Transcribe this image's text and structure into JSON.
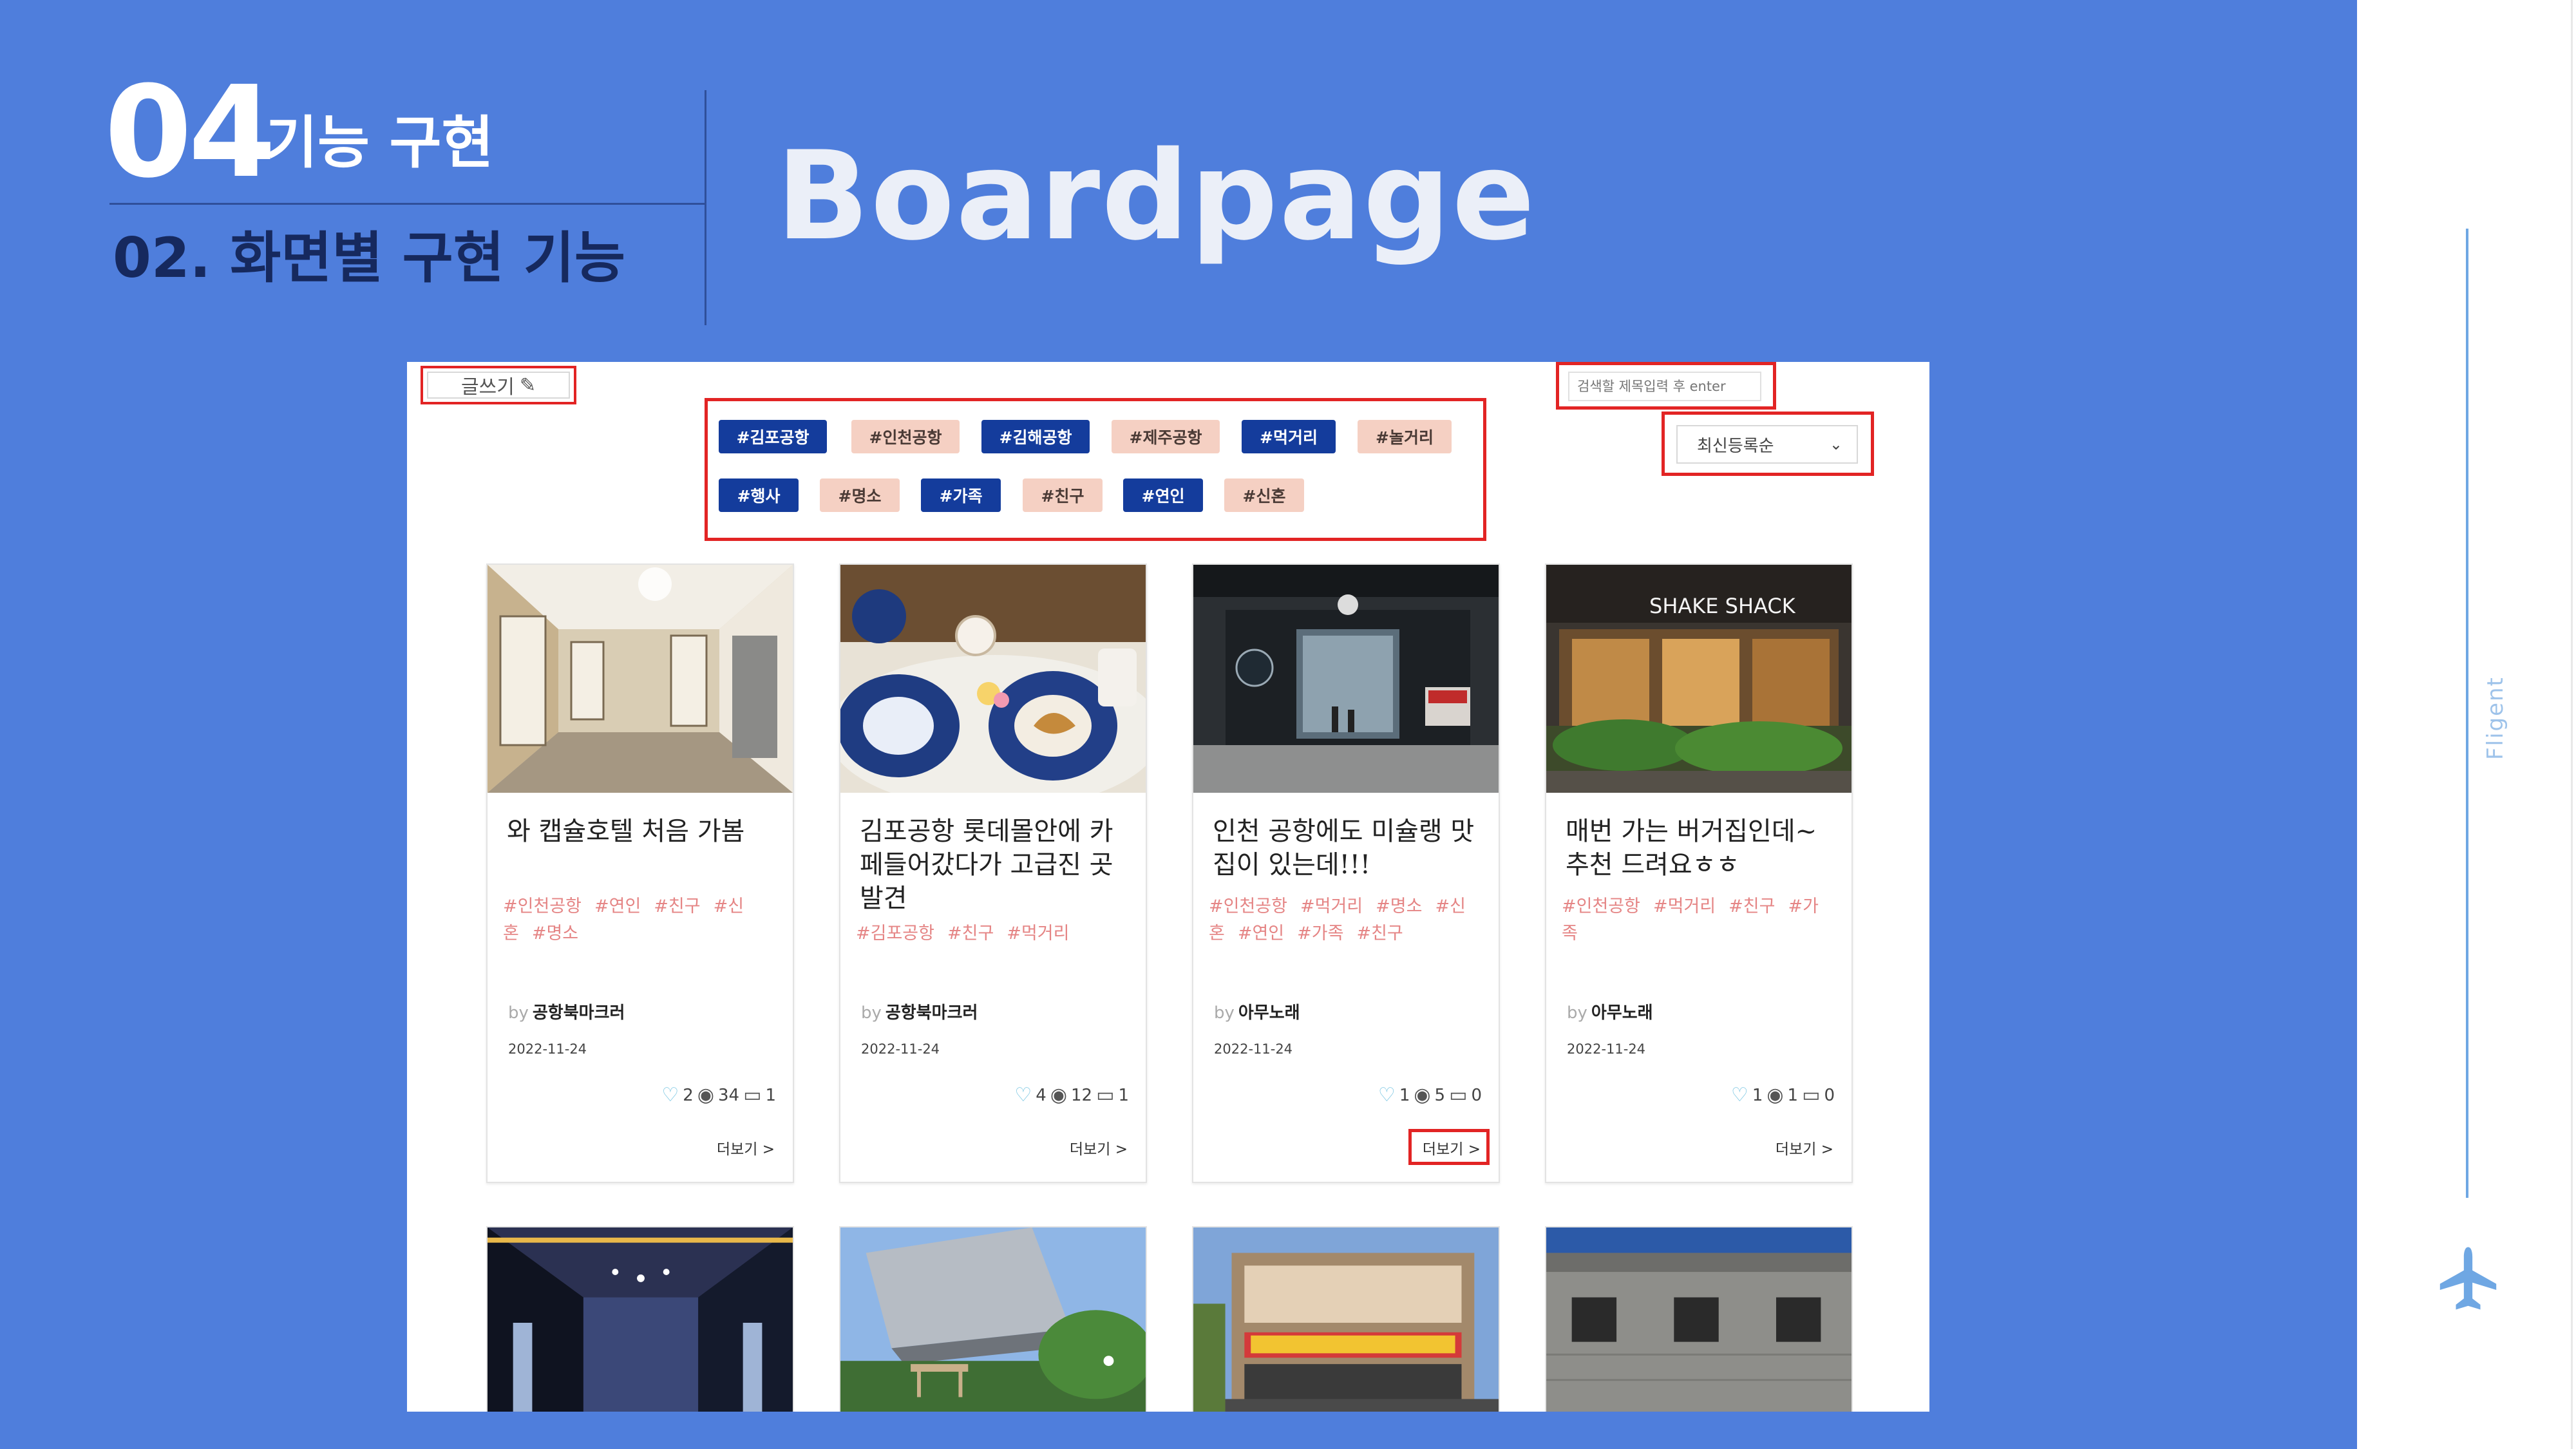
{
  "slide": {
    "number": "04",
    "subtitle": "기능 구현",
    "section": "02. 화면별 구현 기능",
    "page_title": "Boardpage",
    "brand": "Fligent"
  },
  "board": {
    "write_label": "글쓰기",
    "search_placeholder": "검색할 제목입력 후 enter",
    "sort_label": "최신등록순",
    "tags": [
      {
        "label": "#김포공항",
        "active": true
      },
      {
        "label": "#인천공항",
        "active": false
      },
      {
        "label": "#김해공항",
        "active": true
      },
      {
        "label": "#제주공항",
        "active": false
      },
      {
        "label": "#먹거리",
        "active": true
      },
      {
        "label": "#놀거리",
        "active": false
      },
      {
        "label": "#행사",
        "active": true
      },
      {
        "label": "#명소",
        "active": false
      },
      {
        "label": "#가족",
        "active": true
      },
      {
        "label": "#친구",
        "active": false
      },
      {
        "label": "#연인",
        "active": true
      },
      {
        "label": "#신혼",
        "active": false
      }
    ],
    "posts": [
      {
        "title": "와 캡슐호텔 처음 가봄",
        "tags_line1": [
          "#인천공항",
          "#연인",
          "#친구",
          "#신"
        ],
        "tags_line2": [
          "혼",
          "#명소"
        ],
        "by": "by",
        "author": "공항북마크러",
        "date": "2022-11-24",
        "likes": "2",
        "views": "34",
        "comments": "1",
        "more": "더보기 >"
      },
      {
        "title": "김포공항 롯데몰안에 카페들어갔다가 고급진 곳 발견",
        "tags_line1": [
          "#김포공항",
          "#친구",
          "#먹거리"
        ],
        "tags_line2": [],
        "by": "by",
        "author": "공항북마크러",
        "date": "2022-11-24",
        "likes": "4",
        "views": "12",
        "comments": "1",
        "more": "더보기 >"
      },
      {
        "title": "인천 공항에도 미슐랭 맛집이 있는데!!!",
        "tags_line1": [
          "#인천공항",
          "#먹거리",
          "#명소",
          "#신"
        ],
        "tags_line2": [
          "혼",
          "#연인",
          "#가족",
          "#친구"
        ],
        "by": "by",
        "author": "아무노래",
        "date": "2022-11-24",
        "likes": "1",
        "views": "5",
        "comments": "0",
        "more": "더보기 >"
      },
      {
        "title": "매번 가는 버거집인데~ 추천 드려요ㅎㅎ",
        "tags_line1": [
          "#인천공항",
          "#먹거리",
          "#친구",
          "#가"
        ],
        "tags_line2": [
          "족"
        ],
        "by": "by",
        "author": "아무노래",
        "date": "2022-11-24",
        "likes": "1",
        "views": "1",
        "comments": "0",
        "more": "더보기 >",
        "sign": "SHAKE SHACK"
      }
    ]
  },
  "colors": {
    "slide_bg": "#4f7edc",
    "tag_active": "#143c9c",
    "tag_inactive": "#f5d0c3",
    "highlight": "#e22424",
    "post_tag": "#e58585"
  }
}
